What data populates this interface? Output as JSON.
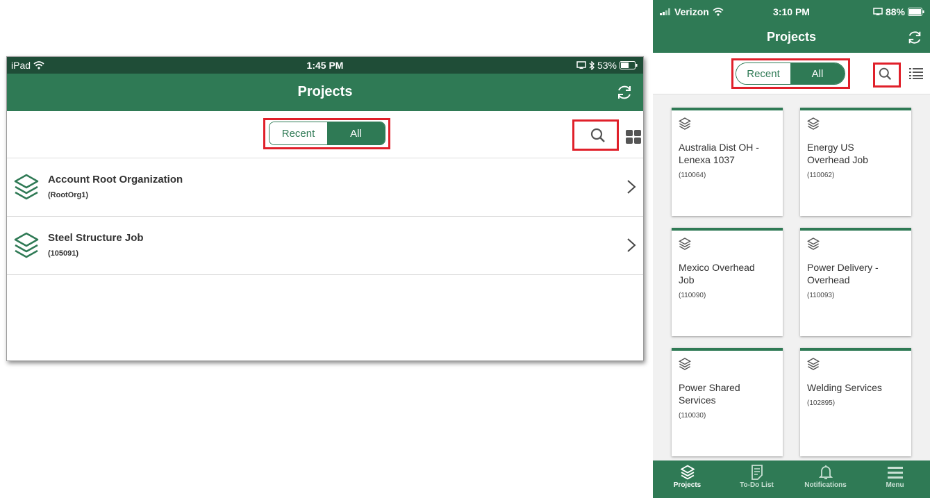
{
  "colors": {
    "accent": "#2f7a55",
    "accent_dark": "#1f4d37",
    "highlight_box": "#e0202a"
  },
  "ipad": {
    "status": {
      "device": "iPad",
      "time": "1:45 PM",
      "battery": "53%"
    },
    "title": "Projects",
    "segment": {
      "recent": "Recent",
      "all": "All",
      "selected": "All"
    },
    "icons": {
      "refresh": "refresh-icon",
      "search": "search-icon",
      "view_toggle": "grid-view-icon"
    },
    "projects": [
      {
        "name": "Account Root Organization",
        "code": "(RootOrg1)"
      },
      {
        "name": "Steel Structure Job",
        "code": "(105091)"
      }
    ]
  },
  "iphone": {
    "status": {
      "carrier": "Verizon",
      "time": "3:10 PM",
      "battery": "88%"
    },
    "title": "Projects",
    "segment": {
      "recent": "Recent",
      "all": "All",
      "selected": "All"
    },
    "icons": {
      "refresh": "refresh-icon",
      "search": "search-icon",
      "view_toggle": "list-view-icon"
    },
    "projects": [
      {
        "name": "Australia Dist OH - Lenexa 1037",
        "code": "(110064)"
      },
      {
        "name": "Energy US Overhead Job",
        "code": "(110062)"
      },
      {
        "name": "Mexico Overhead Job",
        "code": "(110090)"
      },
      {
        "name": "Power Delivery - Overhead",
        "code": "(110093)"
      },
      {
        "name": "Power Shared Services",
        "code": "(110030)"
      },
      {
        "name": "Welding Services",
        "code": "(102895)"
      }
    ],
    "tabs": [
      {
        "label": "Projects",
        "active": true
      },
      {
        "label": "To-Do List",
        "active": false
      },
      {
        "label": "Notifications",
        "active": false
      },
      {
        "label": "Menu",
        "active": false
      }
    ]
  }
}
